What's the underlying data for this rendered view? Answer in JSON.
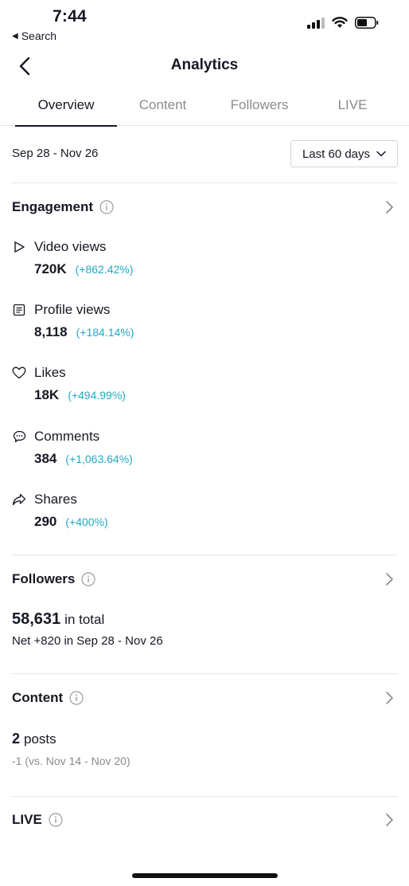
{
  "status_bar": {
    "time": "7:44",
    "back_app": "Search",
    "icons": [
      "cellular-signal-icon",
      "wifi-icon",
      "battery-icon"
    ]
  },
  "nav": {
    "title": "Analytics",
    "back_icon": "chevron-left-icon"
  },
  "tabs": [
    {
      "label": "Overview",
      "active": true
    },
    {
      "label": "Content",
      "active": false
    },
    {
      "label": "Followers",
      "active": false
    },
    {
      "label": "LIVE",
      "active": false
    }
  ],
  "date_range": {
    "label": "Sep 28 - Nov 26",
    "selector": "Last 60 days"
  },
  "engagement": {
    "title": "Engagement",
    "metrics": [
      {
        "label": "Video views",
        "value": "720K",
        "change": "(+862.42%)",
        "icon": "play-icon"
      },
      {
        "label": "Profile views",
        "value": "8,118",
        "change": "(+184.14%)",
        "icon": "document-icon"
      },
      {
        "label": "Likes",
        "value": "18K",
        "change": "(+494.99%)",
        "icon": "heart-icon"
      },
      {
        "label": "Comments",
        "value": "384",
        "change": "(+1,063.64%)",
        "icon": "comment-icon"
      },
      {
        "label": "Shares",
        "value": "290",
        "change": "(+400%)",
        "icon": "share-icon"
      }
    ]
  },
  "followers": {
    "title": "Followers",
    "total": "58,631",
    "total_suffix": "in total",
    "net": "Net +820 in Sep 28 - Nov 26"
  },
  "content": {
    "title": "Content",
    "count": "2",
    "count_suffix": "posts",
    "comparison": "-1 (vs. Nov 14 - Nov 20)"
  },
  "live": {
    "title": "LIVE"
  },
  "colors": {
    "accent_change": "#23a9c3",
    "text_primary": "#161823",
    "text_muted": "#8a8b91"
  }
}
